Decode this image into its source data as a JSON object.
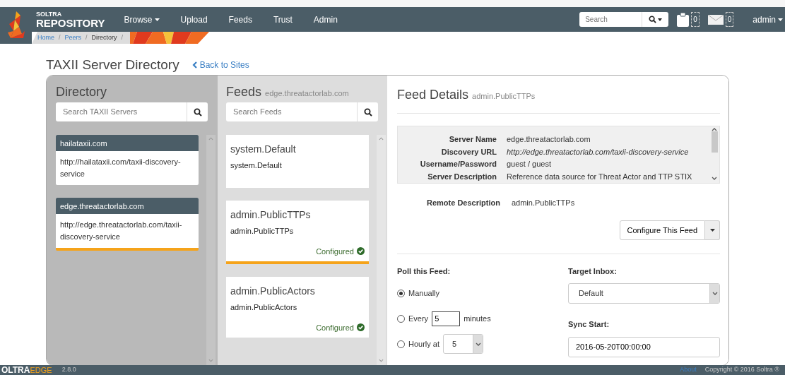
{
  "navbar": {
    "brand_top": "SOLTRA",
    "brand_bottom": "REPOSITORY",
    "menu": [
      {
        "label": "Browse",
        "dropdown": true
      },
      {
        "label": "Upload",
        "dropdown": false
      },
      {
        "label": "Feeds",
        "dropdown": false
      },
      {
        "label": "Trust",
        "dropdown": false
      },
      {
        "label": "Admin",
        "dropdown": false
      }
    ],
    "search": {
      "placeholder": "Search"
    },
    "counters": [
      {
        "kind": "clipboard",
        "count": "0"
      },
      {
        "kind": "mail",
        "count": "0"
      }
    ],
    "user": "admin"
  },
  "breadcrumb": [
    {
      "label": "Home",
      "current": false,
      "separator": "/"
    },
    {
      "label": "Peers",
      "current": false,
      "separator": "/"
    },
    {
      "label": "Directory",
      "current": true,
      "separator": "/"
    }
  ],
  "page": {
    "title": "TAXII Server Directory",
    "back_link": "Back to Sites"
  },
  "directory": {
    "title": "Directory",
    "search": {
      "placeholder": "Search TAXII Servers"
    },
    "servers": [
      {
        "name": "hailataxii.com",
        "url": "http://hailataxii.com/taxii-discovery-service",
        "selected": false
      },
      {
        "name": "edge.threatactorlab.com",
        "url": "http://edge.threatactorlab.com/taxii-discovery-service",
        "selected": true
      }
    ]
  },
  "feeds": {
    "title": "Feeds",
    "subtitle": "edge.threatactorlab.com",
    "search": {
      "placeholder": "Search Feeds"
    },
    "items": [
      {
        "title": "system.Default",
        "subtitle": "system.Default",
        "configured": false,
        "selected": false
      },
      {
        "title": "admin.PublicTTPs",
        "subtitle": "admin.PublicTTPs",
        "configured": true,
        "status": "Configured",
        "selected": true
      },
      {
        "title": "admin.PublicActors",
        "subtitle": "admin.PublicActors",
        "configured": true,
        "status": "Configured",
        "selected": false
      }
    ]
  },
  "details": {
    "title": "Feed Details",
    "subtitle": "admin.PublicTTPs",
    "info": [
      {
        "label": "Server Name",
        "value": "edge.threatactorlab.com",
        "kind": "text"
      },
      {
        "label": "Discovery URL",
        "value": "http://edge.threatactorlab.com/taxii-discovery-service",
        "kind": "url"
      },
      {
        "label": "Username/Password",
        "value": "guest / guest",
        "kind": "text"
      },
      {
        "label": "Server Description",
        "value": "Reference data source for Threat Actor and TTP  STIX",
        "kind": "text"
      }
    ],
    "remote_description": {
      "label": "Remote Description",
      "value": "admin.PublicTTPs"
    },
    "configure_button": "Configure This Feed",
    "poll": {
      "label": "Poll this Feed:",
      "options": [
        {
          "kind": "manual",
          "label": "Manually",
          "selected": true
        },
        {
          "kind": "every",
          "label": "Every",
          "value": "5",
          "suffix": "minutes",
          "selected": false
        },
        {
          "kind": "hourly",
          "label": "Hourly at",
          "value": "5",
          "selected": false
        }
      ]
    },
    "target_inbox": {
      "label": "Target Inbox:",
      "value": "Default"
    },
    "sync_start": {
      "label": "Sync Start:",
      "value": "2016-05-20T00:00:00"
    }
  },
  "footer": {
    "brand": "OLTRA",
    "brand_suffix": "EDGE",
    "version": "2.8.0",
    "about": "About",
    "copyright": "Copyright © 2016 Soltra ®"
  }
}
